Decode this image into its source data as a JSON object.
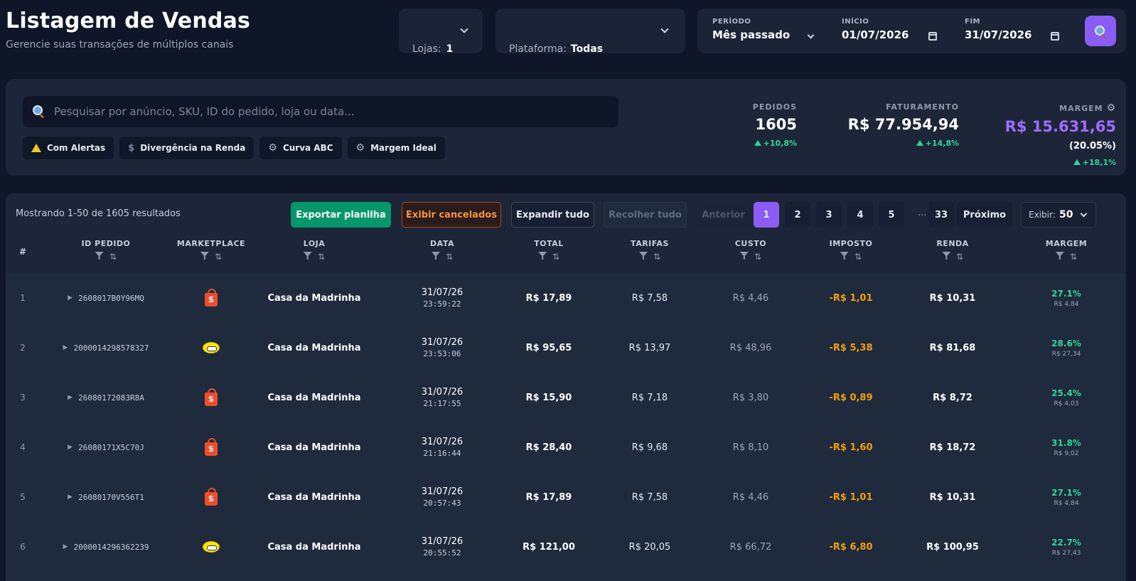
{
  "header": {
    "title": "Listagem de Vendas",
    "subtitle": "Gerencie suas transações de múltiplos canais",
    "lojas_label": "Lojas:",
    "lojas_value": "1",
    "plataforma_label": "Plataforma:",
    "plataforma_value": "Todas",
    "periodo_label": "PERÍODO",
    "periodo_value": "Mês passado",
    "inicio_label": "INÍCIO",
    "inicio_value": "01/07/2026",
    "fim_label": "FIM",
    "fim_value": "31/07/2026",
    "search_icon": "search-icon"
  },
  "filters": {
    "search_placeholder": "Pesquisar por anúncio, SKU, ID do pedido, loja ou data...",
    "chips": [
      {
        "label": "Com Alertas",
        "icon": "warning-icon"
      },
      {
        "label": "Divergência na Renda",
        "icon": "dollar-icon"
      },
      {
        "label": "Curva ABC",
        "icon": "gear-icon"
      },
      {
        "label": "Margem Ideal",
        "icon": "gear-icon"
      }
    ]
  },
  "stats": {
    "pedidos_label": "PEDIDOS",
    "pedidos_value": "1605",
    "pedidos_change": "+10,8%",
    "faturamento_label": "FATURAMENTO",
    "faturamento_value": "R$ 77.954,94",
    "faturamento_change": "+14,8%",
    "margem_label": "MARGEM",
    "margem_value": "R$ 15.631,65",
    "margem_pct": "(20.05%)",
    "margem_change": "+18,1%"
  },
  "toolbar": {
    "showing": "Mostrando 1-50 de 1605 resultados",
    "export": "Exportar planilha",
    "cancelled": "Exibir cancelados",
    "expand": "Expandir tudo",
    "collapse": "Recolher tudo",
    "prev": "Anterior",
    "pages": [
      "1",
      "2",
      "3",
      "4",
      "5"
    ],
    "ellipsis": "...",
    "last_page": "33",
    "next": "Próximo",
    "per_page_label": "Exibir:",
    "per_page_value": "50"
  },
  "table": {
    "columns": {
      "idx": "#",
      "id": "ID PEDIDO",
      "marketplace": "MARKETPLACE",
      "loja": "LOJA",
      "data": "DATA",
      "total": "TOTAL",
      "tarifas": "TARIFAS",
      "custo": "CUSTO",
      "imposto": "IMPOSTO",
      "renda": "RENDA",
      "margem": "MARGEM"
    },
    "rows": [
      {
        "idx": "1",
        "id": "2608017B0Y96MQ",
        "mk": "shopee",
        "loja": "Casa da Madrinha",
        "date": "31/07/26",
        "time": "23:59:22",
        "total": "R$ 17,89",
        "fee": "R$ 7,58",
        "cost": "R$ 4,46",
        "tax": "-R$ 1,01",
        "inc": "R$ 10,31",
        "mp": "27.1%",
        "ma": "R$ 4,84"
      },
      {
        "idx": "2",
        "id": "2000014298578327",
        "mk": "mercadolivre",
        "loja": "Casa da Madrinha",
        "date": "31/07/26",
        "time": "23:53:06",
        "total": "R$ 95,65",
        "fee": "R$ 13,97",
        "cost": "R$ 48,96",
        "tax": "-R$ 5,38",
        "inc": "R$ 81,68",
        "mp": "28.6%",
        "ma": "R$ 27,34"
      },
      {
        "idx": "3",
        "id": "26080172083R8A",
        "mk": "shopee",
        "loja": "Casa da Madrinha",
        "date": "31/07/26",
        "time": "21:17:55",
        "total": "R$ 15,90",
        "fee": "R$ 7,18",
        "cost": "R$ 3,80",
        "tax": "-R$ 0,89",
        "inc": "R$ 8,72",
        "mp": "25.4%",
        "ma": "R$ 4,03"
      },
      {
        "idx": "4",
        "id": "26080171X5C70J",
        "mk": "shopee",
        "loja": "Casa da Madrinha",
        "date": "31/07/26",
        "time": "21:16:44",
        "total": "R$ 28,40",
        "fee": "R$ 9,68",
        "cost": "R$ 8,10",
        "tax": "-R$ 1,60",
        "inc": "R$ 18,72",
        "mp": "31.8%",
        "ma": "R$ 9,02"
      },
      {
        "idx": "5",
        "id": "26080170V556T1",
        "mk": "shopee",
        "loja": "Casa da Madrinha",
        "date": "31/07/26",
        "time": "20:57:43",
        "total": "R$ 17,89",
        "fee": "R$ 7,58",
        "cost": "R$ 4,46",
        "tax": "-R$ 1,01",
        "inc": "R$ 10,31",
        "mp": "27.1%",
        "ma": "R$ 4,84"
      },
      {
        "idx": "6",
        "id": "2000014296362239",
        "mk": "mercadolivre",
        "loja": "Casa da Madrinha",
        "date": "31/07/26",
        "time": "20:55:52",
        "total": "R$ 121,00",
        "fee": "R$ 20,05",
        "cost": "R$ 66,72",
        "tax": "-R$ 6,80",
        "inc": "R$ 100,95",
        "mp": "22.7%",
        "ma": "R$ 27,43"
      }
    ]
  },
  "colors": {
    "background": "#0e1627",
    "accent": "#8b5cf6",
    "positive": "#34d399",
    "tax": "#f59e0b",
    "export": "#059669"
  }
}
